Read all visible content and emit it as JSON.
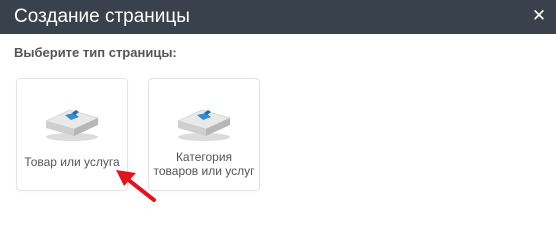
{
  "dialog": {
    "title": "Создание страницы",
    "close_icon": "close-icon",
    "prompt": "Выберите тип страницы:"
  },
  "page_types": [
    {
      "label": "Товар или услуга",
      "icon": "box-icon"
    },
    {
      "label_line1": "Категория",
      "label_line2": "товаров или услуг",
      "icon": "box-icon"
    }
  ],
  "annotation": {
    "icon": "red-arrow-icon",
    "color": "#e0141e"
  },
  "colors": {
    "titlebar": "#39424c",
    "box_accent": "#2f8fd0"
  }
}
